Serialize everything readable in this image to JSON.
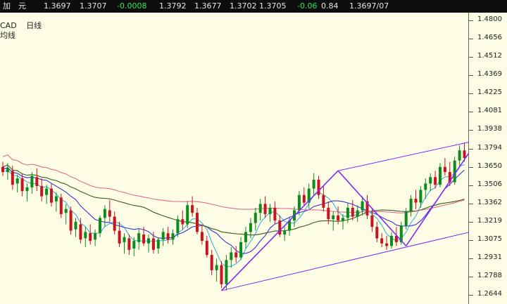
{
  "header": {
    "name_chars": "加　元",
    "price_1": "1.3697",
    "price_2": "1.3707",
    "change": "-0.0008",
    "price_3": "1.3792",
    "price_4": "1.3677",
    "price_5": "1.3702",
    "price_6": "1.3705",
    "change_2": "-0.06",
    "value_7": "0.84",
    "price_8": "1.3697/07"
  },
  "chart_label": {
    "symbol": "CAD",
    "period": "日线",
    "ma_label": "均线"
  },
  "colors": {
    "up_candle": "#0f8a1c",
    "down_candle": "#c8141e",
    "ma_cyan": "#38b4dc",
    "ma_blue": "#3a32d6",
    "ma_green": "#385c1e",
    "ma_pink": "#dc6e8c",
    "trend_purple": "#7c2cf4",
    "arrow_blue": "#1e3ef0"
  },
  "chart_data": {
    "type": "candlestick",
    "price_axis": {
      "ticks": [
        "1.4800",
        "1.4656",
        "1.4512",
        "1.4369",
        "1.4225",
        "1.4081",
        "1.3938",
        "1.3794",
        "1.3650",
        "1.3506",
        "1.3362",
        "1.3219",
        "1.3075",
        "1.2931",
        "1.2788",
        "1.2644"
      ],
      "range": [
        1.2575,
        1.486
      ]
    },
    "ohlc": [
      [
        1.365,
        1.369,
        1.358,
        1.361
      ],
      [
        1.361,
        1.368,
        1.355,
        1.364
      ],
      [
        1.362,
        1.366,
        1.347,
        1.351
      ],
      [
        1.352,
        1.359,
        1.345,
        1.356
      ],
      [
        1.356,
        1.36,
        1.342,
        1.346
      ],
      [
        1.346,
        1.352,
        1.338,
        1.349
      ],
      [
        1.349,
        1.361,
        1.344,
        1.358
      ],
      [
        1.357,
        1.364,
        1.346,
        1.35
      ],
      [
        1.35,
        1.356,
        1.338,
        1.342
      ],
      [
        1.343,
        1.351,
        1.336,
        1.348
      ],
      [
        1.348,
        1.352,
        1.334,
        1.337
      ],
      [
        1.338,
        1.345,
        1.33,
        1.342
      ],
      [
        1.341,
        1.344,
        1.325,
        1.328
      ],
      [
        1.329,
        1.336,
        1.32,
        1.332
      ],
      [
        1.331,
        1.334,
        1.312,
        1.315
      ],
      [
        1.316,
        1.325,
        1.31,
        1.322
      ],
      [
        1.32,
        1.325,
        1.305,
        1.308
      ],
      [
        1.309,
        1.318,
        1.302,
        1.314
      ],
      [
        1.313,
        1.32,
        1.304,
        1.307
      ],
      [
        1.308,
        1.316,
        1.303,
        1.313
      ],
      [
        1.313,
        1.327,
        1.31,
        1.325
      ],
      [
        1.325,
        1.335,
        1.318,
        1.332
      ],
      [
        1.331,
        1.339,
        1.322,
        1.326
      ],
      [
        1.326,
        1.33,
        1.312,
        1.315
      ],
      [
        1.315,
        1.322,
        1.302,
        1.305
      ],
      [
        1.306,
        1.313,
        1.297,
        1.31
      ],
      [
        1.309,
        1.312,
        1.296,
        1.3
      ],
      [
        1.301,
        1.31,
        1.295,
        1.307
      ],
      [
        1.306,
        1.316,
        1.3,
        1.313
      ],
      [
        1.312,
        1.318,
        1.303,
        1.305
      ],
      [
        1.305,
        1.312,
        1.298,
        1.309
      ],
      [
        1.309,
        1.314,
        1.297,
        1.3
      ],
      [
        1.301,
        1.31,
        1.297,
        1.308
      ],
      [
        1.308,
        1.317,
        1.303,
        1.314
      ],
      [
        1.313,
        1.318,
        1.305,
        1.308
      ],
      [
        1.308,
        1.316,
        1.304,
        1.313
      ],
      [
        1.313,
        1.327,
        1.31,
        1.324
      ],
      [
        1.324,
        1.331,
        1.316,
        1.32
      ],
      [
        1.32,
        1.338,
        1.317,
        1.335
      ],
      [
        1.335,
        1.342,
        1.326,
        1.329
      ],
      [
        1.329,
        1.333,
        1.312,
        1.314
      ],
      [
        1.314,
        1.32,
        1.304,
        1.307
      ],
      [
        1.307,
        1.311,
        1.294,
        1.296
      ],
      [
        1.296,
        1.3,
        1.28,
        1.284
      ],
      [
        1.284,
        1.293,
        1.275,
        1.288
      ],
      [
        1.288,
        1.291,
        1.27,
        1.273
      ],
      [
        1.273,
        1.296,
        1.268,
        1.292
      ],
      [
        1.292,
        1.302,
        1.286,
        1.298
      ],
      [
        1.298,
        1.303,
        1.29,
        1.294
      ],
      [
        1.294,
        1.31,
        1.292,
        1.306
      ],
      [
        1.306,
        1.318,
        1.301,
        1.314
      ],
      [
        1.314,
        1.325,
        1.309,
        1.321
      ],
      [
        1.321,
        1.333,
        1.315,
        1.329
      ],
      [
        1.329,
        1.34,
        1.323,
        1.336
      ],
      [
        1.336,
        1.342,
        1.325,
        1.328
      ],
      [
        1.328,
        1.336,
        1.322,
        1.333
      ],
      [
        1.333,
        1.338,
        1.32,
        1.323
      ],
      [
        1.323,
        1.327,
        1.31,
        1.312
      ],
      [
        1.312,
        1.318,
        1.307,
        1.315
      ],
      [
        1.315,
        1.326,
        1.311,
        1.323
      ],
      [
        1.323,
        1.334,
        1.318,
        1.331
      ],
      [
        1.331,
        1.346,
        1.327,
        1.343
      ],
      [
        1.343,
        1.349,
        1.334,
        1.337
      ],
      [
        1.337,
        1.352,
        1.332,
        1.348
      ],
      [
        1.348,
        1.36,
        1.342,
        1.355
      ],
      [
        1.355,
        1.358,
        1.34,
        1.343
      ],
      [
        1.343,
        1.35,
        1.33,
        1.333
      ],
      [
        1.333,
        1.338,
        1.32,
        1.324
      ],
      [
        1.324,
        1.33,
        1.315,
        1.327
      ],
      [
        1.327,
        1.334,
        1.32,
        1.323
      ],
      [
        1.323,
        1.328,
        1.316,
        1.325
      ],
      [
        1.325,
        1.337,
        1.321,
        1.333
      ],
      [
        1.333,
        1.339,
        1.323,
        1.326
      ],
      [
        1.326,
        1.335,
        1.322,
        1.331
      ],
      [
        1.331,
        1.342,
        1.327,
        1.338
      ],
      [
        1.338,
        1.343,
        1.324,
        1.327
      ],
      [
        1.327,
        1.332,
        1.314,
        1.318
      ],
      [
        1.318,
        1.322,
        1.306,
        1.309
      ],
      [
        1.309,
        1.313,
        1.302,
        1.305
      ],
      [
        1.305,
        1.311,
        1.3,
        1.303
      ],
      [
        1.303,
        1.314,
        1.301,
        1.311
      ],
      [
        1.311,
        1.318,
        1.303,
        1.306
      ],
      [
        1.306,
        1.322,
        1.304,
        1.319
      ],
      [
        1.319,
        1.333,
        1.316,
        1.33
      ],
      [
        1.33,
        1.343,
        1.326,
        1.34
      ],
      [
        1.34,
        1.347,
        1.332,
        1.337
      ],
      [
        1.337,
        1.35,
        1.333,
        1.347
      ],
      [
        1.347,
        1.356,
        1.34,
        1.352
      ],
      [
        1.352,
        1.36,
        1.346,
        1.357
      ],
      [
        1.357,
        1.362,
        1.348,
        1.351
      ],
      [
        1.351,
        1.368,
        1.349,
        1.365
      ],
      [
        1.365,
        1.372,
        1.358,
        1.361
      ],
      [
        1.361,
        1.369,
        1.35,
        1.353
      ],
      [
        1.353,
        1.373,
        1.351,
        1.37
      ],
      [
        1.37,
        1.382,
        1.365,
        1.378
      ],
      [
        1.378,
        1.384,
        1.369,
        1.372
      ]
    ]
  }
}
